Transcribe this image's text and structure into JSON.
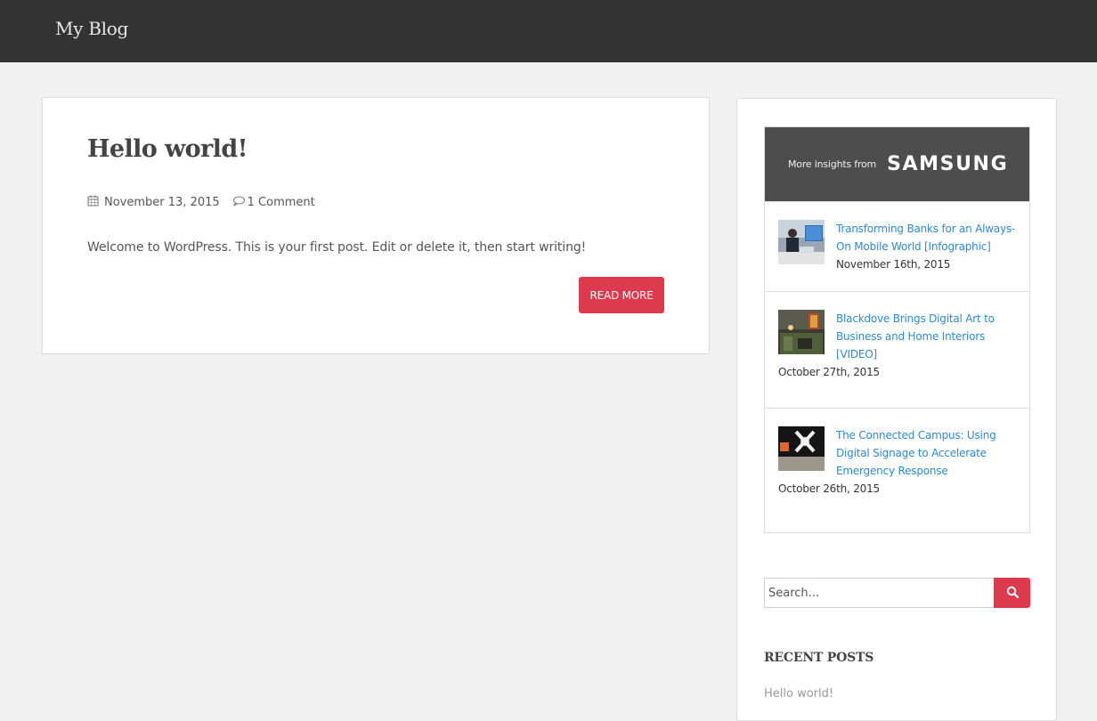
{
  "header": {
    "site_title": "My Blog"
  },
  "post": {
    "title": "Hello world!",
    "date": "November 13, 2015",
    "comments": "1 Comment",
    "excerpt": "Welcome to WordPress. This is your first post. Edit or delete it, then start writing!",
    "read_more_label": "READ MORE",
    "icons": {
      "date": "calendar-icon",
      "comments": "comment-icon"
    }
  },
  "sidebar": {
    "sponsor": {
      "lead": "More insights from",
      "brand": "SAMSUNG",
      "items": [
        {
          "title": "Transforming Banks for an Always-On Mobile World [Infographic]",
          "date": "November 16th, 2015",
          "thumb": "office-meeting-photo"
        },
        {
          "title": "Blackdove Brings Digital Art to Business and Home Interiors [VIDEO]",
          "date": "October 27th, 2015",
          "thumb": "interior-art-photo"
        },
        {
          "title": "The Connected Campus: Using Digital Signage to Accelerate Emergency Response",
          "date": "October 26th, 2015",
          "thumb": "signage-photo"
        }
      ]
    },
    "search": {
      "placeholder": "Search..."
    },
    "recent_posts": {
      "title": "RECENT POSTS",
      "items": [
        "Hello world!"
      ]
    }
  },
  "colors": {
    "header_bg": "#333333",
    "accent": "#dd3b4d",
    "link": "#2f8ac9",
    "page_bg": "#f1f1f1"
  }
}
